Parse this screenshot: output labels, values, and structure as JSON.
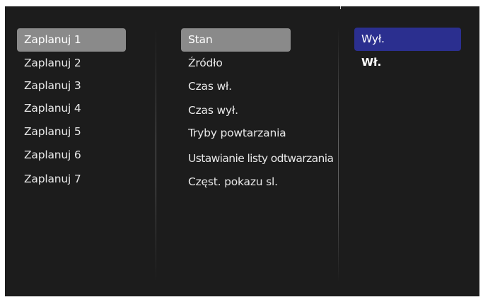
{
  "menu": {
    "schedules": [
      {
        "label": "Zaplanuj 1"
      },
      {
        "label": "Zaplanuj 2"
      },
      {
        "label": "Zaplanuj 3"
      },
      {
        "label": "Zaplanuj 4"
      },
      {
        "label": "Zaplanuj 5"
      },
      {
        "label": "Zaplanuj 6"
      },
      {
        "label": "Zaplanuj 7"
      }
    ],
    "settings": [
      {
        "label": "Stan"
      },
      {
        "label": "Źródło"
      },
      {
        "label": "Czas wł."
      },
      {
        "label": "Czas wył."
      },
      {
        "label": "Tryby powtarzania"
      },
      {
        "label": "Ustawianie listy odtwarzania"
      },
      {
        "label": "Częst. pokazu sl."
      }
    ],
    "options": [
      {
        "label": "Wył."
      },
      {
        "label": "Wł."
      }
    ],
    "selected_schedule": "Zaplanuj 1",
    "selected_setting": "Stan",
    "selected_option": "Wył.",
    "current_value": "Wł."
  },
  "colors": {
    "background": "#1c1c1c",
    "highlight_grey": "#8a8a8a",
    "highlight_blue": "#2b2f8f",
    "text": "#e8e8e8"
  }
}
